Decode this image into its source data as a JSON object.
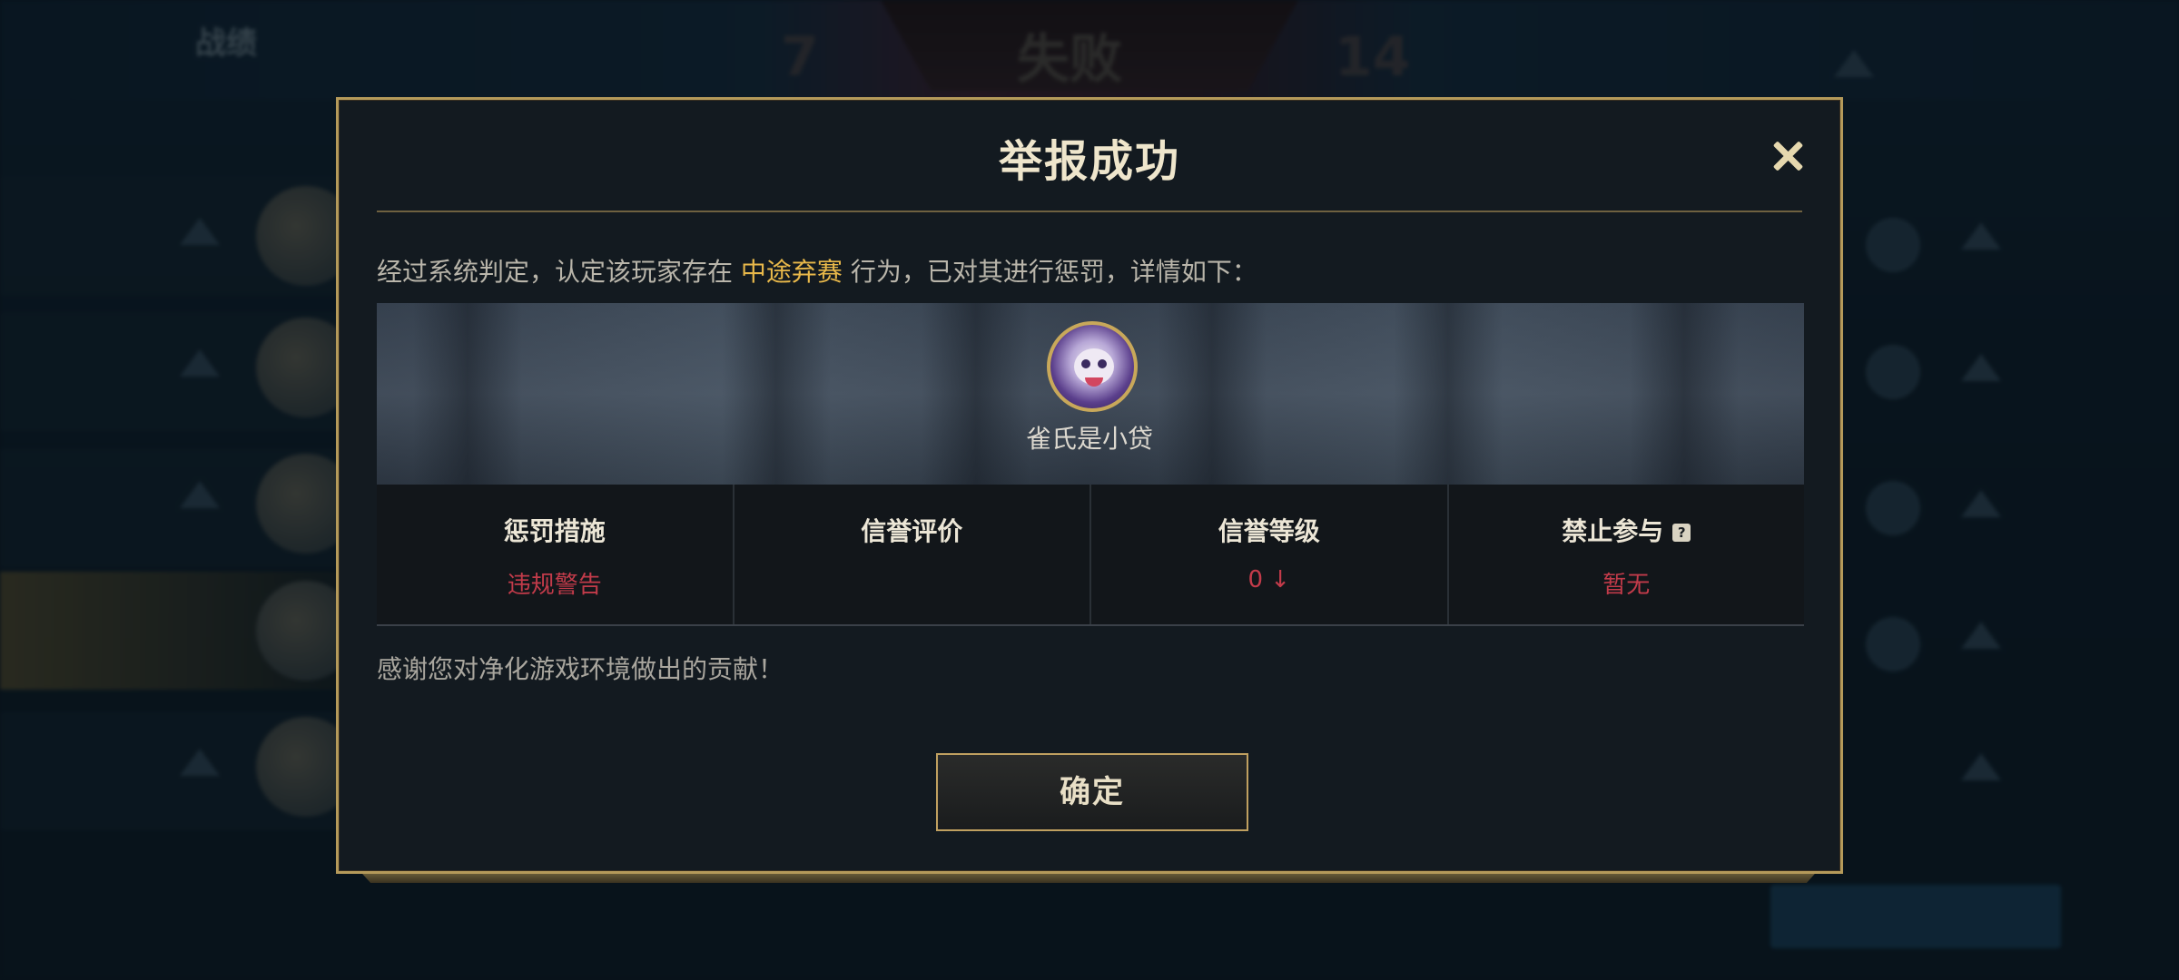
{
  "background": {
    "title": "战绩",
    "score_left": "7",
    "score_center": "失败",
    "score_right": "14"
  },
  "dialog": {
    "title": "举报成功",
    "close_icon": "close-icon",
    "verdict_prefix": "经过系统判定，认定该玩家存在",
    "verdict_highlight": "中途弃赛",
    "verdict_suffix": "行为，已对其进行惩罚，详情如下：",
    "player": {
      "name": "雀氏是小贷",
      "avatar_icon": "player-avatar"
    },
    "stats": [
      {
        "label": "惩罚措施",
        "value": "违规警告"
      },
      {
        "label": "信誉评价",
        "value": ""
      },
      {
        "label": "信誉等级",
        "value": "0 ↓"
      },
      {
        "label": "禁止参与",
        "value": "暂无",
        "help": "?"
      }
    ],
    "thanks": "感谢您对净化游戏环境做出的贡献！",
    "confirm_label": "确定"
  },
  "colors": {
    "accent_gold": "#b59a5a",
    "highlight": "#e8b84a",
    "penalty_red": "#c23b4a"
  }
}
